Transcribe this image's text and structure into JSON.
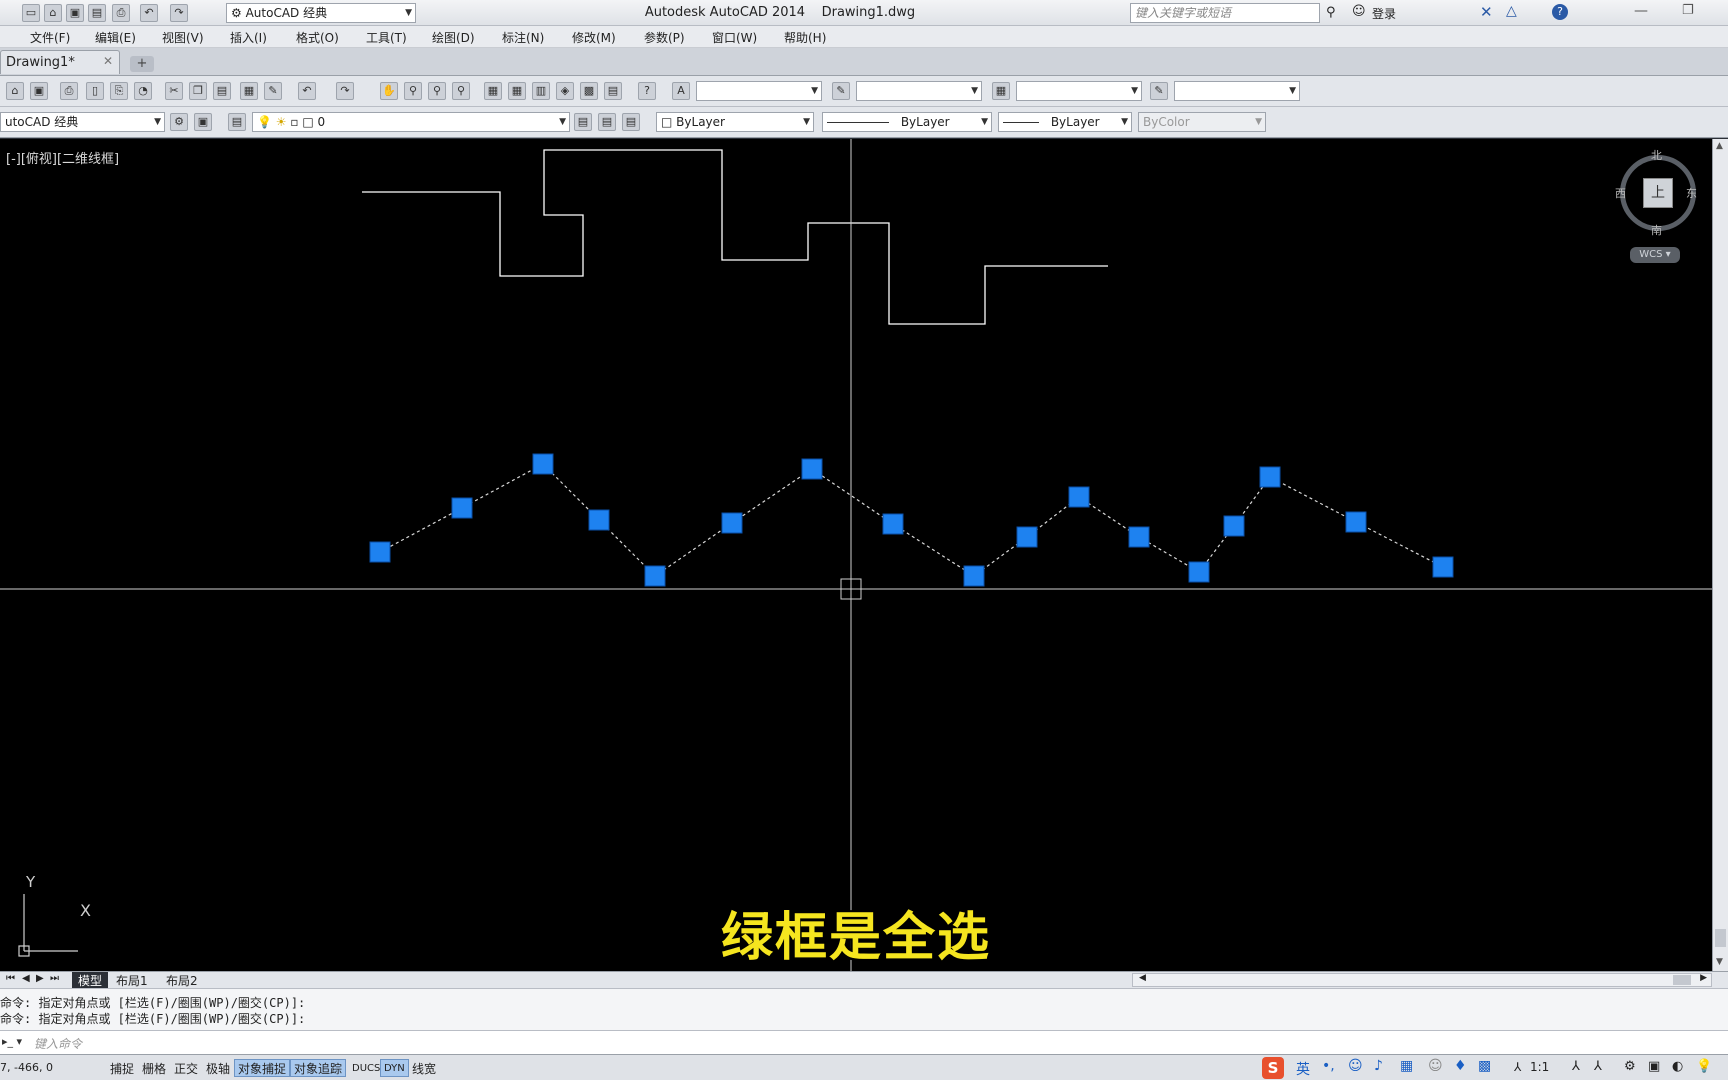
{
  "window": {
    "title": "Autodesk AutoCAD 2014    Drawing1.dwg",
    "workspace": "AutoCAD 经典",
    "search_placeholder": "键入关键字或短语",
    "login": "登录"
  },
  "menu": [
    "文件(F)",
    "编辑(E)",
    "视图(V)",
    "插入(I)",
    "格式(O)",
    "工具(T)",
    "绘图(D)",
    "标注(N)",
    "修改(M)",
    "参数(P)",
    "窗口(W)",
    "帮助(H)"
  ],
  "tabs": {
    "active": "Drawing1*"
  },
  "toolbar2": {
    "workspace": "utoCAD 经典",
    "layer": "0",
    "color": "ByLayer",
    "linetype": "ByLayer",
    "lineweight": "ByLayer",
    "plotstyle": "ByColor"
  },
  "viewport": {
    "label": "[-][俯视][二维线框]",
    "viewcube": {
      "north": "北",
      "south": "南",
      "east": "东",
      "west": "西",
      "top": "上",
      "wcs": "WCS"
    },
    "ucs": {
      "x": "X",
      "y": "Y"
    }
  },
  "subtitle": "绿框是全选",
  "layout_tabs": [
    "模型",
    "布局1",
    "布局2"
  ],
  "command_history": [
    "命令: 指定对角点或 [栏选(F)/圈围(WP)/圈交(CP)]:",
    "命令: 指定对角点或 [栏选(F)/圈围(WP)/圈交(CP)]:"
  ],
  "command_placeholder": "键入命令",
  "status": {
    "coords": "7, -466, 0",
    "buttons": [
      {
        "label": "捕捉",
        "on": false
      },
      {
        "label": "栅格",
        "on": false
      },
      {
        "label": "正交",
        "on": false
      },
      {
        "label": "极轴",
        "on": false
      },
      {
        "label": "对象捕捉",
        "on": true
      },
      {
        "label": "对象追踪",
        "on": true
      },
      {
        "label": "DUCS",
        "on": false
      },
      {
        "label": "DYN",
        "on": true
      },
      {
        "label": "线宽",
        "on": false
      }
    ],
    "ime": "英",
    "scale": "1:1"
  },
  "colors": {
    "grip": "#1e82f0",
    "subtitle": "#f5e51f",
    "canvas": "#000000"
  }
}
